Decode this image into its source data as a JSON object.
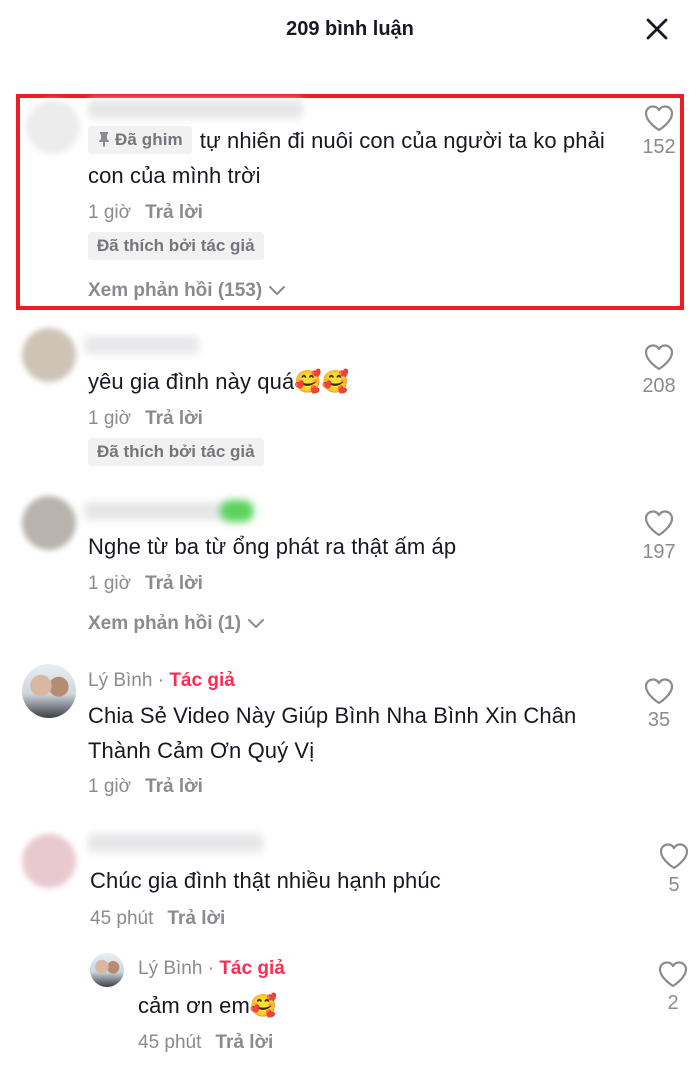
{
  "header": {
    "title": "209 bình luận",
    "close_icon": "close-icon"
  },
  "comments": [
    {
      "pinned_label": "Đã ghim",
      "text": "tự nhiên đi nuôi con của người ta ko phải con của mình trời",
      "time": "1 giờ",
      "reply_label": "Trả lời",
      "liked_by_author": "Đã thích bởi tác giả",
      "view_replies": "Xem phản hồi (153)",
      "likes": "152"
    },
    {
      "text": "yêu gia đình này quá🥰🥰",
      "time": "1 giờ",
      "reply_label": "Trả lời",
      "liked_by_author": "Đã thích bởi tác giả",
      "likes": "208"
    },
    {
      "text": "Nghe từ ba từ ổng phát ra thật ấm áp",
      "time": "1 giờ",
      "reply_label": "Trả lời",
      "view_replies": "Xem phản hồi (1)",
      "likes": "197"
    },
    {
      "author": "Lý Bình",
      "author_tag": "Tác giả",
      "text": "Chia Sẻ Video Này Giúp Bình Nha Bình Xin Chân Thành Cảm Ơn Quý Vị",
      "time": "1 giờ",
      "reply_label": "Trả lời",
      "likes": "35"
    },
    {
      "text": "Chúc gia đình thật nhiều hạnh phúc",
      "time": "45 phút",
      "reply_label": "Trả lời",
      "likes": "5"
    }
  ],
  "reply": {
    "author": "Lý Bình",
    "author_tag": "Tác giả",
    "text": "cảm ơn em🥰",
    "time": "45 phút",
    "reply_label": "Trả lời",
    "likes": "2"
  },
  "colors": {
    "highlight": "#ee1c24",
    "author_tag": "#fe2c55",
    "muted": "#8a8b91"
  },
  "icons": {
    "like": "heart-outline-icon",
    "pin": "pin-icon",
    "chevron": "chevron-down-icon"
  }
}
